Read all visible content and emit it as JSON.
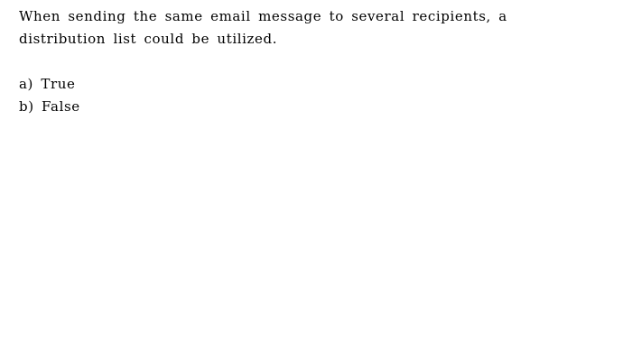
{
  "question": {
    "line1": "When sending the same email message to several recipients, a",
    "line2": "distribution list could be utilized."
  },
  "options": [
    {
      "letter": "a)",
      "text": "True"
    },
    {
      "letter": "b)",
      "text": "False"
    }
  ]
}
